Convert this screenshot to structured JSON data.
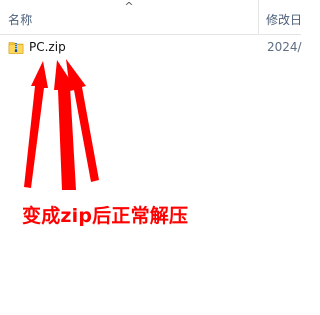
{
  "explorer": {
    "sort_indicator": "^",
    "columns": {
      "name": "名称",
      "modified": "修改日"
    },
    "files": [
      {
        "name": "PC.zip",
        "modified": "2024/",
        "icon": "zip-folder-icon"
      }
    ]
  },
  "annotation": {
    "text": "变成zip后正常解压",
    "color": "#ff0000"
  }
}
